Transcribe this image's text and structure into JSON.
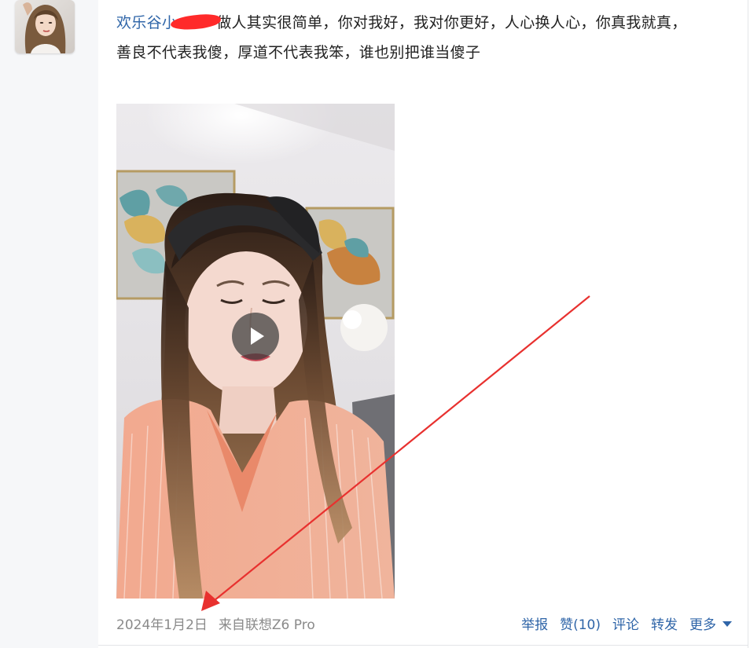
{
  "post": {
    "username": "欢乐谷小",
    "text_line1": "做人其实很简单，你对我好，我对你更好，人心换人心，你真我就真，",
    "text_line2": "善良不代表我傻，厚道不代表我笨，谁也别把谁当傻子"
  },
  "footer": {
    "date": "2024年1月2日",
    "source": "来自联想Z6 Pro"
  },
  "actions": {
    "report": "举报",
    "like": "赞(10)",
    "comment": "评论",
    "repost": "转发",
    "more": "更多"
  },
  "colors": {
    "link": "#2f65a8",
    "meta": "#8a8a8a",
    "annotation_arrow": "#e8312f",
    "redaction": "#ff2a2a"
  },
  "icons": {
    "play": "play-icon",
    "more": "chevron-down-icon"
  }
}
